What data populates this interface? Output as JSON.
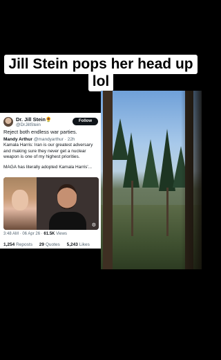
{
  "caption": {
    "line1": "Jill Stein pops her head up",
    "line2": "lol"
  },
  "tweet": {
    "author_name": "Dr. Jill Stein🌻",
    "author_handle": "@DrJillStein",
    "follow_label": "Follow",
    "text": "Reject both endless war parties.",
    "quote": {
      "author_name": "Mandy Arthur",
      "author_handle": "@mandyarthur",
      "age": "· 22h",
      "text": "Kamala Harris: Iran is our greatest adversary and making sure they never get a nuclear weapon is one of my highest priorities.",
      "text2": "MAGA has literally adopted Kamala Harris'..."
    },
    "meta": {
      "time": "3:48 AM · 06 Apr 26 ·",
      "views_count": "61.5K",
      "views_label": "Views"
    },
    "stats": {
      "reposts_count": "1,254",
      "reposts_label": "Reposts",
      "quotes_count": "29",
      "quotes_label": "Quotes",
      "likes_count": "5,243",
      "likes_label": "Likes"
    }
  }
}
